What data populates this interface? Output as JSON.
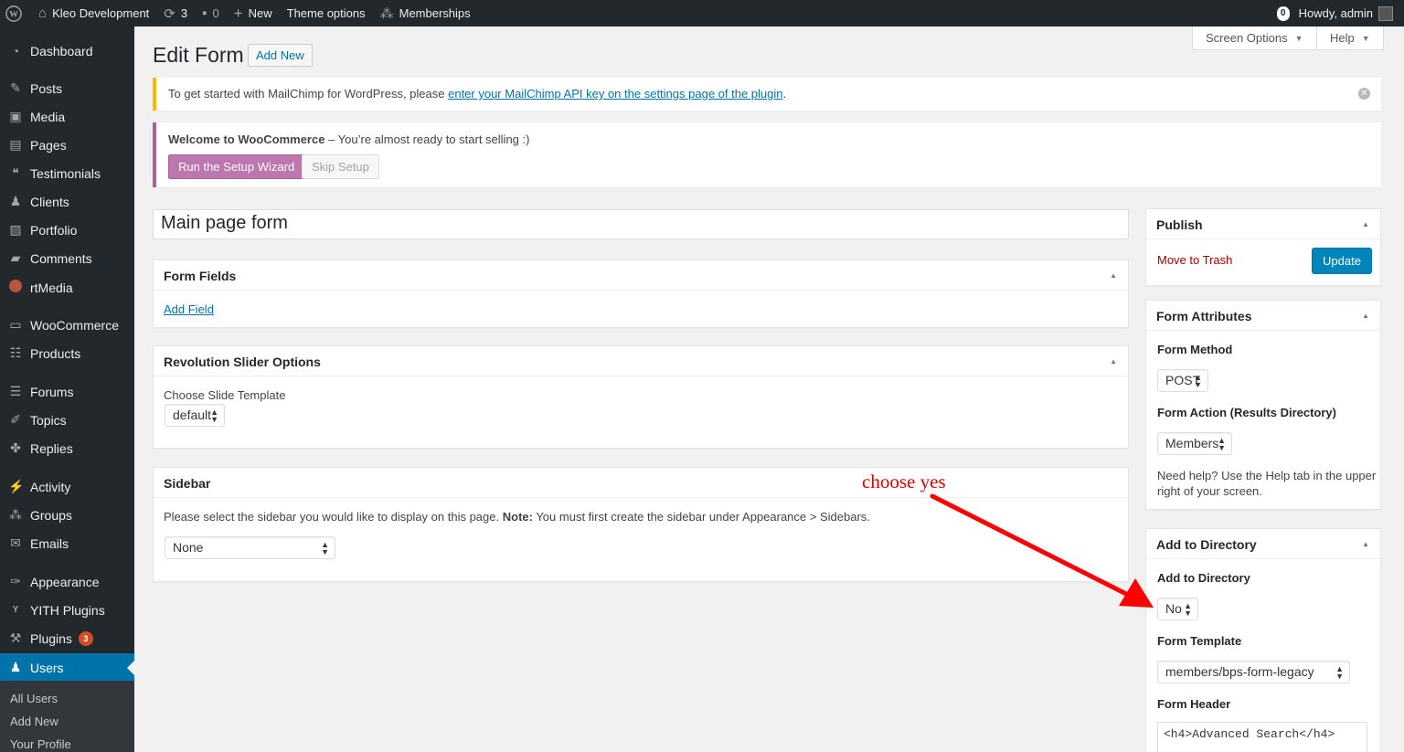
{
  "adminbar": {
    "site_name": "Kleo Development",
    "updates_count": "3",
    "comments_count": "0",
    "new_label": "New",
    "theme_options_label": "Theme options",
    "memberships_label": "Memberships",
    "notif_count": "0",
    "howdy": "Howdy, admin"
  },
  "sidebar": {
    "items": [
      {
        "label": "Dashboard",
        "icon": "dashboard-icon"
      },
      {
        "label": "Posts",
        "icon": "pin-icon"
      },
      {
        "label": "Media",
        "icon": "media-icon"
      },
      {
        "label": "Pages",
        "icon": "pages-icon"
      },
      {
        "label": "Testimonials",
        "icon": "quote-icon"
      },
      {
        "label": "Clients",
        "icon": "person-icon"
      },
      {
        "label": "Portfolio",
        "icon": "portfolio-icon"
      },
      {
        "label": "Comments",
        "icon": "comment-icon"
      },
      {
        "label": "rtMedia",
        "icon": "rtmedia-icon"
      },
      {
        "label": "WooCommerce",
        "icon": "woo-icon"
      },
      {
        "label": "Products",
        "icon": "archive-icon"
      },
      {
        "label": "Forums",
        "icon": "forums-icon"
      },
      {
        "label": "Topics",
        "icon": "topics-icon"
      },
      {
        "label": "Replies",
        "icon": "replies-icon"
      },
      {
        "label": "Activity",
        "icon": "activity-icon"
      },
      {
        "label": "Groups",
        "icon": "groups-icon"
      },
      {
        "label": "Emails",
        "icon": "email-icon"
      },
      {
        "label": "Appearance",
        "icon": "brush-icon"
      },
      {
        "label": "YITH Plugins",
        "icon": "yith-icon"
      },
      {
        "label": "Plugins",
        "icon": "plugin-icon",
        "badge": "3"
      },
      {
        "label": "Users",
        "icon": "users-icon"
      }
    ],
    "submenu": [
      "All Users",
      "Add New",
      "Your Profile"
    ]
  },
  "screen_options_label": "Screen Options",
  "help_label": "Help",
  "page_title": "Edit Form",
  "add_new_label": "Add New",
  "mailchimp_notice": {
    "text": "To get started with MailChimp for WordPress, please ",
    "link": "enter your MailChimp API key on the settings page of the plugin",
    "suffix": "."
  },
  "woo_notice": {
    "title": "Welcome to WooCommerce",
    "text": " – You’re almost ready to start selling :)",
    "wizard_label": "Run the Setup Wizard",
    "skip_label": "Skip Setup"
  },
  "form_title_value": "Main page form",
  "form_fields": {
    "title": "Form Fields",
    "add_field_label": "Add Field"
  },
  "revslider": {
    "title": "Revolution Slider Options",
    "template_label": "Choose Slide Template",
    "template_value": "default"
  },
  "sidebar_box": {
    "title": "Sidebar",
    "desc_pre": "Please select the sidebar you would like to display on this page. ",
    "desc_note": "Note:",
    "desc_post": " You must first create the sidebar under Appearance > Sidebars.",
    "value": "None"
  },
  "publish": {
    "title": "Publish",
    "trash_label": "Move to Trash",
    "update_label": "Update"
  },
  "form_attributes": {
    "title": "Form Attributes",
    "method_label": "Form Method",
    "method_value": "POST",
    "action_label": "Form Action (Results Directory)",
    "action_value": "Members",
    "help_text_1": "Need help? Use the Help tab in the upper",
    "help_text_2": "right of your screen."
  },
  "add_to_directory": {
    "title": "Add to Directory",
    "field_label": "Add to Directory",
    "field_value": "No",
    "template_label": "Form Template",
    "template_value": "members/bps-form-legacy",
    "header_label": "Form Header",
    "header_value": "<h4>Advanced Search</h4>"
  },
  "annotation": {
    "text": "choose yes",
    "color": "#e00000"
  },
  "colors": {
    "adminbar": "#23282d",
    "accent": "#0073aa",
    "woo": "#a46497",
    "warning": "#ffb900"
  }
}
